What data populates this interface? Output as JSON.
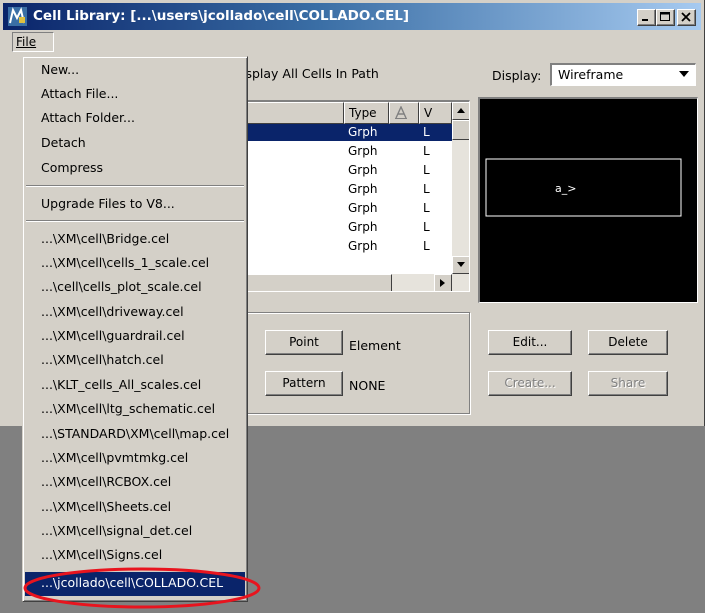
{
  "window": {
    "title": "Cell Library: [...\\users\\jcollado\\cell\\COLLADO.CEL]",
    "icon": "microstation-app-icon"
  },
  "menubar": {
    "file_label": "File"
  },
  "file_menu": {
    "commands": [
      "New...",
      "Attach File...",
      "Attach Folder...",
      "Detach",
      "Compress"
    ],
    "upgrade": "Upgrade Files to V8...",
    "recent_files": [
      "...\\XM\\cell\\Bridge.cel",
      "...\\XM\\cell\\cells_1_scale.cel",
      "...\\cell\\cells_plot_scale.cel",
      "...\\XM\\cell\\driveway.cel",
      "...\\XM\\cell\\guardrail.cel",
      "...\\XM\\cell\\hatch.cel",
      "...\\KLT_cells_All_scales.cel",
      "...\\XM\\cell\\ltg_schematic.cel",
      "...\\STANDARD\\XM\\cell\\map.cel",
      "...\\XM\\cell\\pvmtmkg.cel",
      "...\\XM\\cell\\RCBOX.cel",
      "...\\XM\\cell\\Sheets.cel",
      "...\\XM\\cell\\signal_det.cel",
      "...\\XM\\cell\\Signs.cel",
      "...\\jcollado\\cell\\COLLADO.CEL"
    ],
    "highlight_color": "#e8141e"
  },
  "dialog": {
    "display_all_label": "isplay All Cells In Path",
    "display_label": "Display:",
    "display_value": "Wireframe"
  },
  "table": {
    "headers": {
      "type": "Type",
      "level": "V"
    },
    "rows": [
      {
        "type": "Grph",
        "level": "L"
      },
      {
        "type": "Grph",
        "level": "L"
      },
      {
        "type": "Grph",
        "level": "L"
      },
      {
        "type": "Grph",
        "level": "L"
      },
      {
        "type": "Grph",
        "level": "L"
      },
      {
        "type": "Grph",
        "level": "L"
      },
      {
        "type": "Grph",
        "level": "L"
      }
    ]
  },
  "preview": {
    "cell_text": "a_>"
  },
  "active_cells": {
    "point_button": "Point",
    "point_value": "Element",
    "pattern_button": "Pattern",
    "pattern_value": "NONE"
  },
  "buttons": {
    "edit": "Edit...",
    "delete": "Delete",
    "create": "Create...",
    "share": "Share"
  },
  "colors": {
    "title_active": "#0a246a",
    "selection": "#0a246a",
    "face": "#d4d0c8",
    "workspace": "#808080"
  }
}
